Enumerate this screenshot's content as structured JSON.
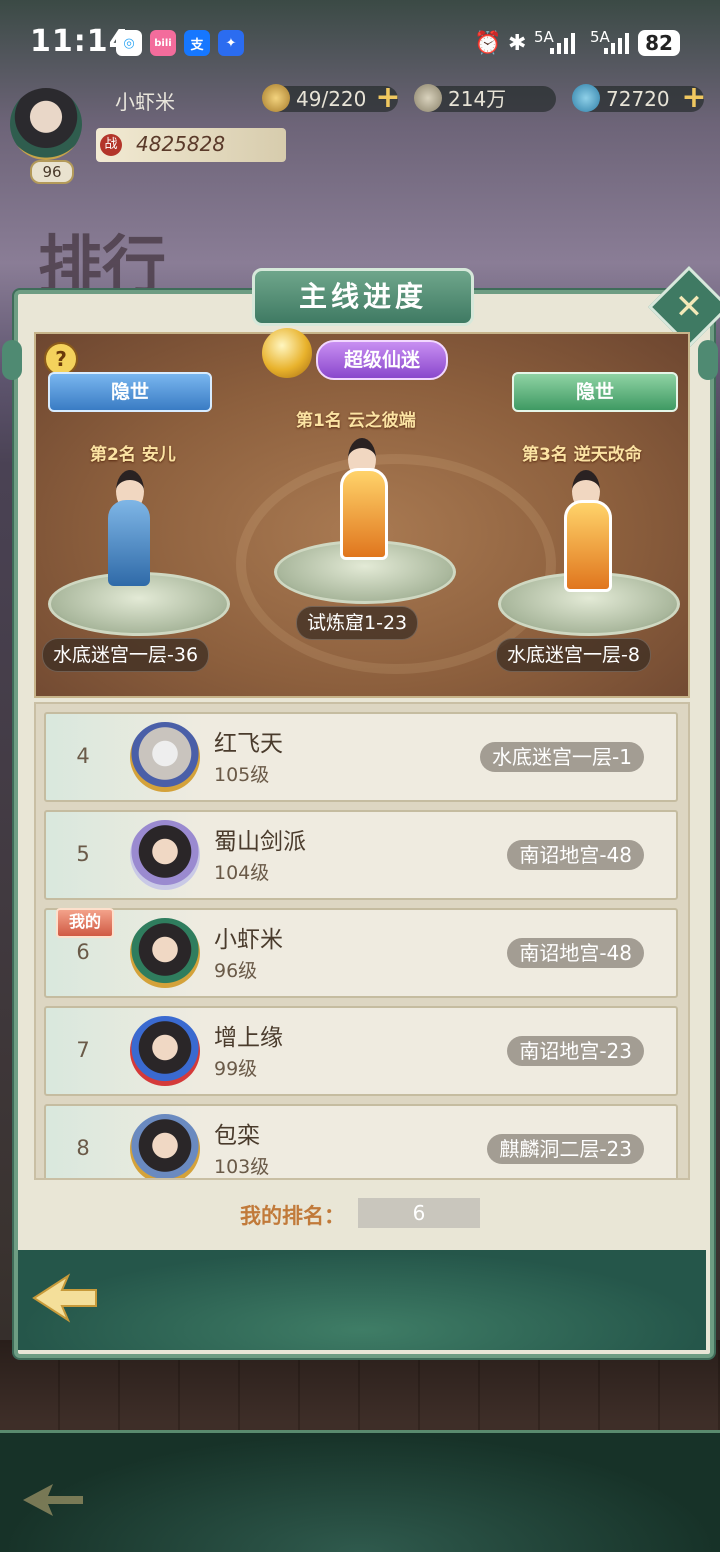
{
  "status_bar": {
    "time": "11:14",
    "apps": [
      {
        "name": "qq-message-icon",
        "glyph": "◎",
        "color": "#ffffff"
      },
      {
        "name": "bilibili-icon",
        "glyph": "bili",
        "color": "#f36c9c"
      },
      {
        "name": "alipay-icon",
        "glyph": "支",
        "color": "#1677ff"
      },
      {
        "name": "lightbulb-icon",
        "glyph": "✦",
        "color": "#2b6cf0"
      }
    ],
    "signal1": "5A",
    "signal2": "5A",
    "battery": "82"
  },
  "player": {
    "name": "小虾米",
    "level": "96",
    "power": "4825828",
    "power_icon": "战"
  },
  "resources": [
    {
      "name": "stamina",
      "value": "49/220"
    },
    {
      "name": "coins",
      "value": "214万"
    },
    {
      "name": "jade",
      "value": "72720"
    }
  ],
  "background": {
    "rank_title": "排行"
  },
  "panel": {
    "title": "主线进度",
    "help": "?",
    "close": "✕"
  },
  "podium": {
    "first": {
      "rank": "第1名  云之彼端",
      "badge": "超级仙迷",
      "location": "试炼窟1-23"
    },
    "second": {
      "rank": "第2名  安儿",
      "badge": "隐世",
      "location": "水底迷宫一层-36"
    },
    "third": {
      "rank": "第3名  逆天改命",
      "badge": "隐世",
      "location": "水底迷宫一层-8"
    }
  },
  "rows": [
    {
      "rank": "4",
      "name": "红飞天",
      "level": "105级",
      "progress": "水底迷宫一层-1"
    },
    {
      "rank": "5",
      "name": "蜀山剑派",
      "level": "104级",
      "progress": "南诏地宫-48"
    },
    {
      "rank": "6",
      "name": "小虾米",
      "level": "96级",
      "progress": "南诏地宫-48",
      "tag": "我的"
    },
    {
      "rank": "7",
      "name": "增上缘",
      "level": "99级",
      "progress": "南诏地宫-23"
    },
    {
      "rank": "8",
      "name": "包栾",
      "level": "103级",
      "progress": "麒麟洞二层-23"
    }
  ],
  "my_rank": {
    "label": "我的排名：",
    "value": "6"
  }
}
